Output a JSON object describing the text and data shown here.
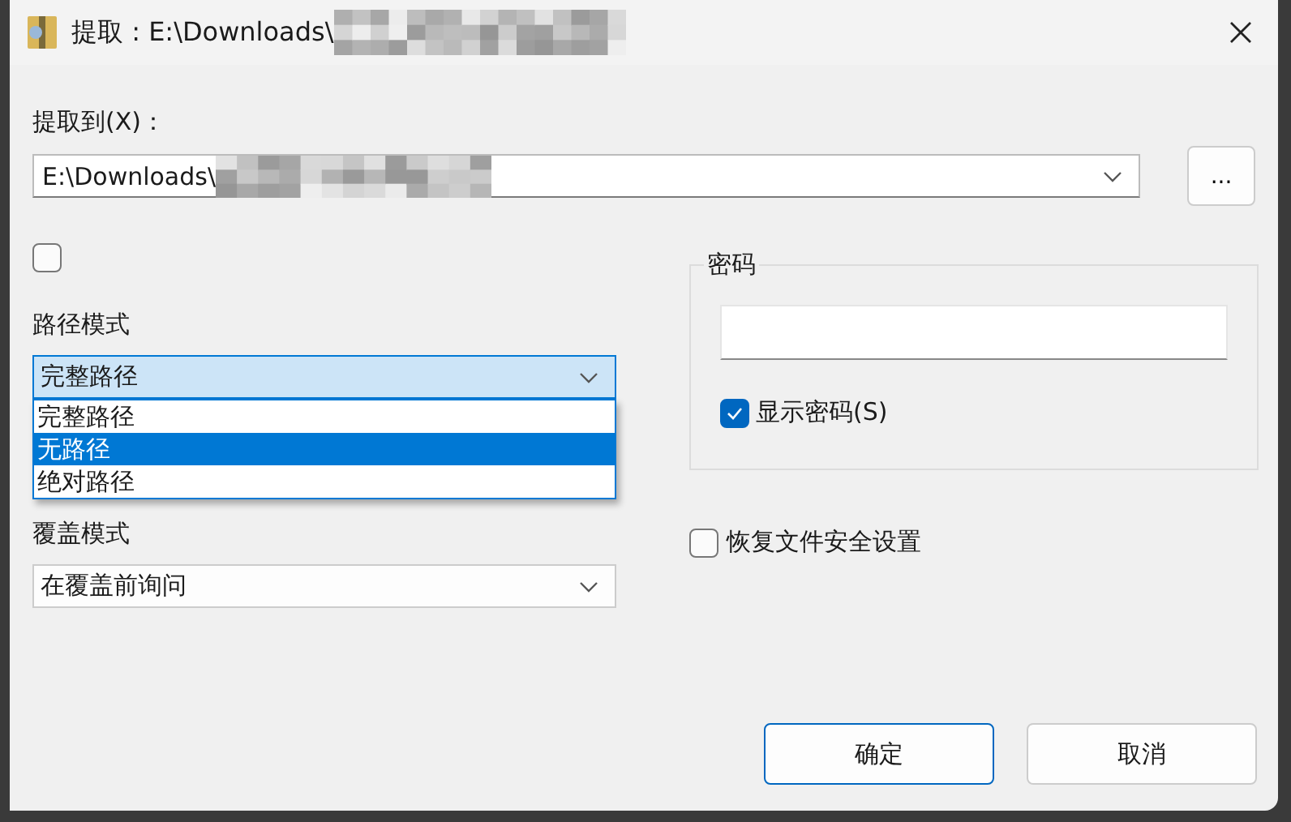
{
  "window": {
    "title": "提取 : E:\\Downloads\\"
  },
  "extract_to": {
    "label": "提取到(X)：",
    "value": "E:\\Downloads\\"
  },
  "browse_button": {
    "label": "..."
  },
  "unlabeled_checkbox": {
    "checked": false
  },
  "path_mode": {
    "label": "路径模式",
    "value": "完整路径",
    "expanded": true,
    "options": [
      {
        "label": "完整路径",
        "highlighted": false
      },
      {
        "label": "无路径",
        "highlighted": true
      },
      {
        "label": "绝对路径",
        "highlighted": false
      }
    ]
  },
  "overwrite_mode": {
    "label": "覆盖模式",
    "value": "在覆盖前询问"
  },
  "password": {
    "title": "密码",
    "show_password": {
      "label": "显示密码(S)",
      "checked": true
    }
  },
  "restore_security": {
    "label": "恢复文件安全设置",
    "checked": false
  },
  "buttons": [
    {
      "label": "确定",
      "default": true
    },
    {
      "label": "取消",
      "default": false
    }
  ]
}
